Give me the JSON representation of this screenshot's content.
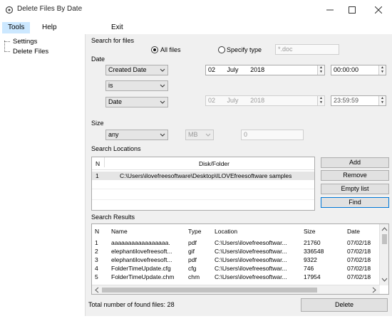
{
  "window": {
    "title": "Delete Files By Date"
  },
  "menu": [
    {
      "label": "Tools"
    },
    {
      "label": "Help"
    },
    {
      "label": "Exit"
    }
  ],
  "tree": [
    {
      "label": "Settings"
    },
    {
      "label": "Delete Files"
    }
  ],
  "search_for": {
    "label": "Search for files",
    "all_files": "All files",
    "specify_type": "Specify type",
    "type_placeholder": "*.doc"
  },
  "date": {
    "label": "Date",
    "criteria": "Created Date",
    "operator": "is",
    "range": "Date",
    "from_day": "02",
    "from_month": "July",
    "from_year": "2018",
    "from_time": "00:00:00",
    "to_day": "02",
    "to_month": "July",
    "to_year": "2018",
    "to_time": "23:59:59"
  },
  "size": {
    "label": "Size",
    "operator": "any",
    "unit": "MB",
    "value": "0"
  },
  "locations": {
    "label": "Search Locations",
    "col_n": "N",
    "col_folder": "Disk/Folder",
    "rows": [
      {
        "n": "1",
        "folder": "C:\\Users\\ilovefreesoftware\\Desktop\\ILOVEfreesoftware samples"
      }
    ],
    "add": "Add",
    "remove": "Remove",
    "empty": "Empty list",
    "find": "Find"
  },
  "results": {
    "label": "Search Results",
    "headers": {
      "n": "N",
      "name": "Name",
      "type": "Type",
      "location": "Location",
      "size": "Size",
      "date": "Date"
    },
    "rows": [
      {
        "n": "1",
        "name": "aaaaaaaaaaaaaaaaa.",
        "type": "pdf",
        "location": "C:\\Users\\ilovefreesoftwar...",
        "size": "21760",
        "date": "07/02/18"
      },
      {
        "n": "2",
        "name": "elephantilovefreesoft...",
        "type": "gif",
        "location": "C:\\Users\\ilovefreesoftwar...",
        "size": "336548",
        "date": "07/02/18"
      },
      {
        "n": "3",
        "name": "elephantilovefreesoft...",
        "type": "pdf",
        "location": "C:\\Users\\ilovefreesoftwar...",
        "size": "9322",
        "date": "07/02/18"
      },
      {
        "n": "4",
        "name": "FolderTimeUpdate.cfg",
        "type": "cfg",
        "location": "C:\\Users\\ilovefreesoftwar...",
        "size": "746",
        "date": "07/02/18"
      },
      {
        "n": "5",
        "name": "FolderTimeUpdate.chm",
        "type": "chm",
        "location": "C:\\Users\\ilovefreesoftwar...",
        "size": "17954",
        "date": "07/02/18"
      }
    ]
  },
  "footer": {
    "total": "Total number of found files: 28",
    "delete": "Delete"
  }
}
